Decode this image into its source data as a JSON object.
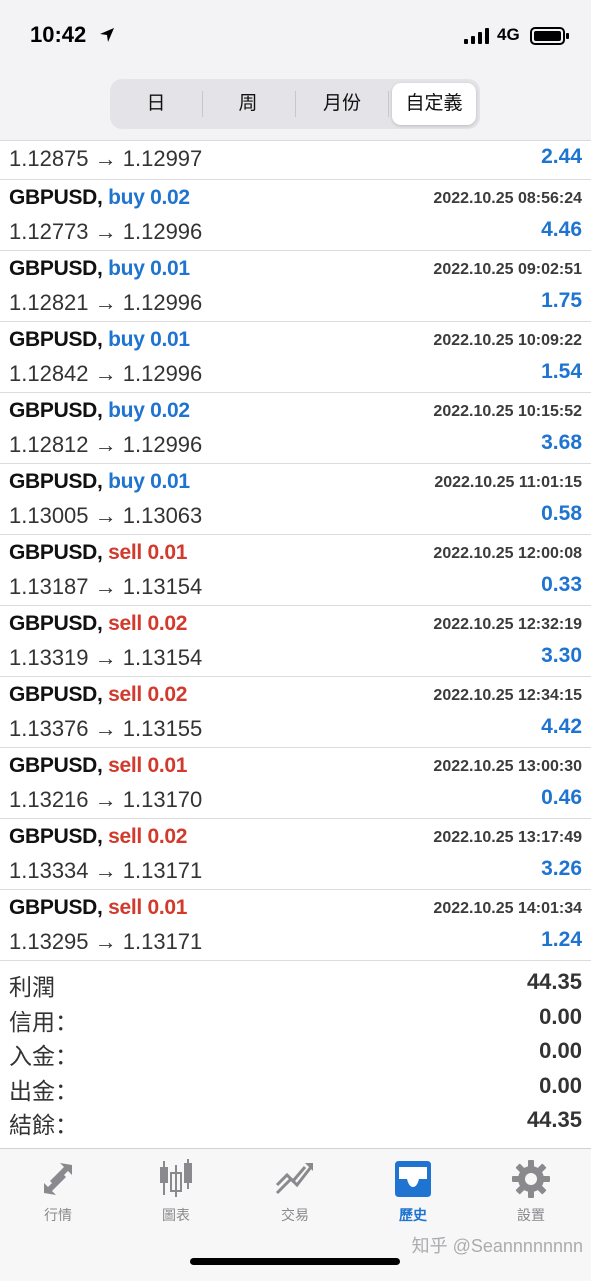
{
  "status": {
    "time": "10:42",
    "network": "4G"
  },
  "tabs_top": {
    "items": [
      "日",
      "周",
      "月份",
      "自定義"
    ],
    "active_index": 3
  },
  "partial_row": {
    "prices": "1.12875 → 1.12997",
    "profit": "2.44"
  },
  "deals": [
    {
      "symbol": "GBPUSD,",
      "direction": "buy 0.02",
      "type": "buy",
      "time": "2022.10.25 08:56:24",
      "prices": "1.12773 → 1.12996",
      "profit": "4.46"
    },
    {
      "symbol": "GBPUSD,",
      "direction": "buy 0.01",
      "type": "buy",
      "time": "2022.10.25 09:02:51",
      "prices": "1.12821 → 1.12996",
      "profit": "1.75"
    },
    {
      "symbol": "GBPUSD,",
      "direction": "buy 0.01",
      "type": "buy",
      "time": "2022.10.25 10:09:22",
      "prices": "1.12842 → 1.12996",
      "profit": "1.54"
    },
    {
      "symbol": "GBPUSD,",
      "direction": "buy 0.02",
      "type": "buy",
      "time": "2022.10.25 10:15:52",
      "prices": "1.12812 → 1.12996",
      "profit": "3.68"
    },
    {
      "symbol": "GBPUSD,",
      "direction": "buy 0.01",
      "type": "buy",
      "time": "2022.10.25 11:01:15",
      "prices": "1.13005 → 1.13063",
      "profit": "0.58"
    },
    {
      "symbol": "GBPUSD,",
      "direction": "sell 0.01",
      "type": "sell",
      "time": "2022.10.25 12:00:08",
      "prices": "1.13187 → 1.13154",
      "profit": "0.33"
    },
    {
      "symbol": "GBPUSD,",
      "direction": "sell 0.02",
      "type": "sell",
      "time": "2022.10.25 12:32:19",
      "prices": "1.13319 → 1.13154",
      "profit": "3.30"
    },
    {
      "symbol": "GBPUSD,",
      "direction": "sell 0.02",
      "type": "sell",
      "time": "2022.10.25 12:34:15",
      "prices": "1.13376 → 1.13155",
      "profit": "4.42"
    },
    {
      "symbol": "GBPUSD,",
      "direction": "sell 0.01",
      "type": "sell",
      "time": "2022.10.25 13:00:30",
      "prices": "1.13216 → 1.13170",
      "profit": "0.46"
    },
    {
      "symbol": "GBPUSD,",
      "direction": "sell 0.02",
      "type": "sell",
      "time": "2022.10.25 13:17:49",
      "prices": "1.13334 → 1.13171",
      "profit": "3.26"
    },
    {
      "symbol": "GBPUSD,",
      "direction": "sell 0.01",
      "type": "sell",
      "time": "2022.10.25 14:01:34",
      "prices": "1.13295 → 1.13171",
      "profit": "1.24"
    }
  ],
  "summary": [
    {
      "label": "利潤",
      "value": "44.35"
    },
    {
      "label": "信用：",
      "value": "0.00"
    },
    {
      "label": "入金：",
      "value": "0.00"
    },
    {
      "label": "出金：",
      "value": "0.00"
    },
    {
      "label": "結餘：",
      "value": "44.35"
    }
  ],
  "bottom_tabs": [
    {
      "label": "行情",
      "icon": "quotes-arrows-icon"
    },
    {
      "label": "圖表",
      "icon": "candlestick-chart-icon"
    },
    {
      "label": "交易",
      "icon": "trade-trend-icon"
    },
    {
      "label": "歷史",
      "icon": "history-tray-icon",
      "active": true
    },
    {
      "label": "設置",
      "icon": "gear-icon"
    }
  ],
  "watermark": "知乎 @Seannnnnnnn",
  "colors": {
    "buy": "#1e74d0",
    "sell": "#d13a2c",
    "profit": "#1e74d0",
    "active_tab": "#1e74d0",
    "inactive_tab": "#8a8a8e"
  }
}
